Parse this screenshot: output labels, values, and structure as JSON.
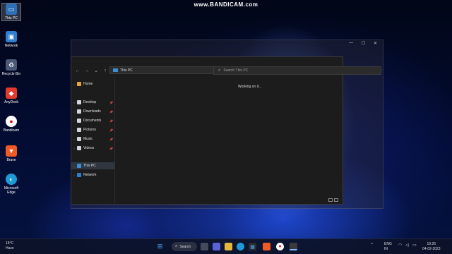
{
  "watermark": "www.BANDICAM.com",
  "desktop_icons": [
    {
      "label": "This PC"
    },
    {
      "label": "Network"
    },
    {
      "label": "Recycle Bin"
    },
    {
      "label": "AnyDesk"
    },
    {
      "label": "Bandicam"
    },
    {
      "label": "Brave"
    },
    {
      "label": "Microsoft Edge"
    }
  ],
  "explorer": {
    "address": "This PC",
    "search_placeholder": "Search This PC",
    "status": "Working on it...",
    "nav_items": [
      {
        "label": "Home",
        "icon": "home-icon"
      },
      {
        "label": "Desktop",
        "icon": "desktop-folder-icon"
      },
      {
        "label": "Downloads",
        "icon": "downloads-folder-icon"
      },
      {
        "label": "Documents",
        "icon": "documents-folder-icon"
      },
      {
        "label": "Pictures",
        "icon": "pictures-folder-icon"
      },
      {
        "label": "Music",
        "icon": "music-folder-icon"
      },
      {
        "label": "Videos",
        "icon": "videos-folder-icon"
      },
      {
        "label": "This PC",
        "icon": "pc-icon"
      },
      {
        "label": "Network",
        "icon": "network-icon"
      }
    ]
  },
  "taskbar": {
    "weather_temp": "18°C",
    "weather_desc": "Haze",
    "search_label": "Search",
    "lang_1": "ENG",
    "lang_2": "IN",
    "time": "19:26",
    "date": "04-02-2023"
  },
  "colors": {
    "accent": "#3c8fd6",
    "taskbar": "#0c1228",
    "explorer_bg": "#1c1c1c"
  }
}
